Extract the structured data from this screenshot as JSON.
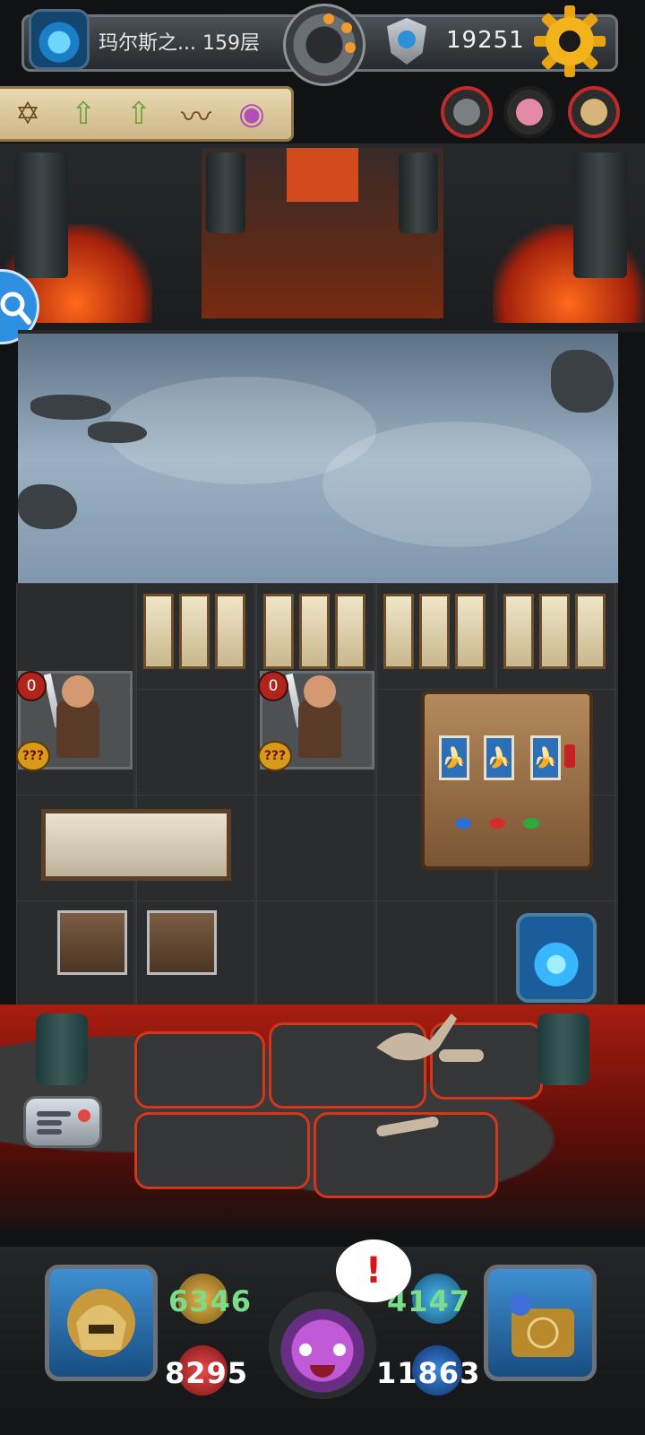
{
  "top_bar": {
    "floor_label": "玛尔斯之... 159层",
    "gold_value": "19251",
    "portal_icon": "portal-icon",
    "bomb_icon": "bomb-icon",
    "shield_icon": "shield-icon",
    "settings_icon": "gear-icon"
  },
  "buffs": [
    {
      "name": "hexagram-icon",
      "glyph": "✡"
    },
    {
      "name": "up-arrow-icon",
      "glyph": "⇧"
    },
    {
      "name": "up-arrow-icon",
      "glyph": "⇧"
    },
    {
      "name": "sound-wave-icon",
      "glyph": "〰"
    },
    {
      "name": "eye-orb-icon",
      "glyph": "◉"
    }
  ],
  "colors": {
    "accent_gold": "#f2b31c",
    "lava": "#d4361a",
    "hp_green": "#7cdc8a",
    "alert_red": "#d8161a"
  },
  "enemies": [
    {
      "attack_badge": "0",
      "defense_badge": "???"
    },
    {
      "attack_badge": "0",
      "defense_badge": "???"
    }
  ],
  "slot_machine": {
    "reel_symbol": "🍌"
  },
  "hud": {
    "stat_top_left": "6346",
    "stat_bottom_left": "8295",
    "stat_top_right": "4147",
    "stat_bottom_right": "11863",
    "alert": "!"
  }
}
